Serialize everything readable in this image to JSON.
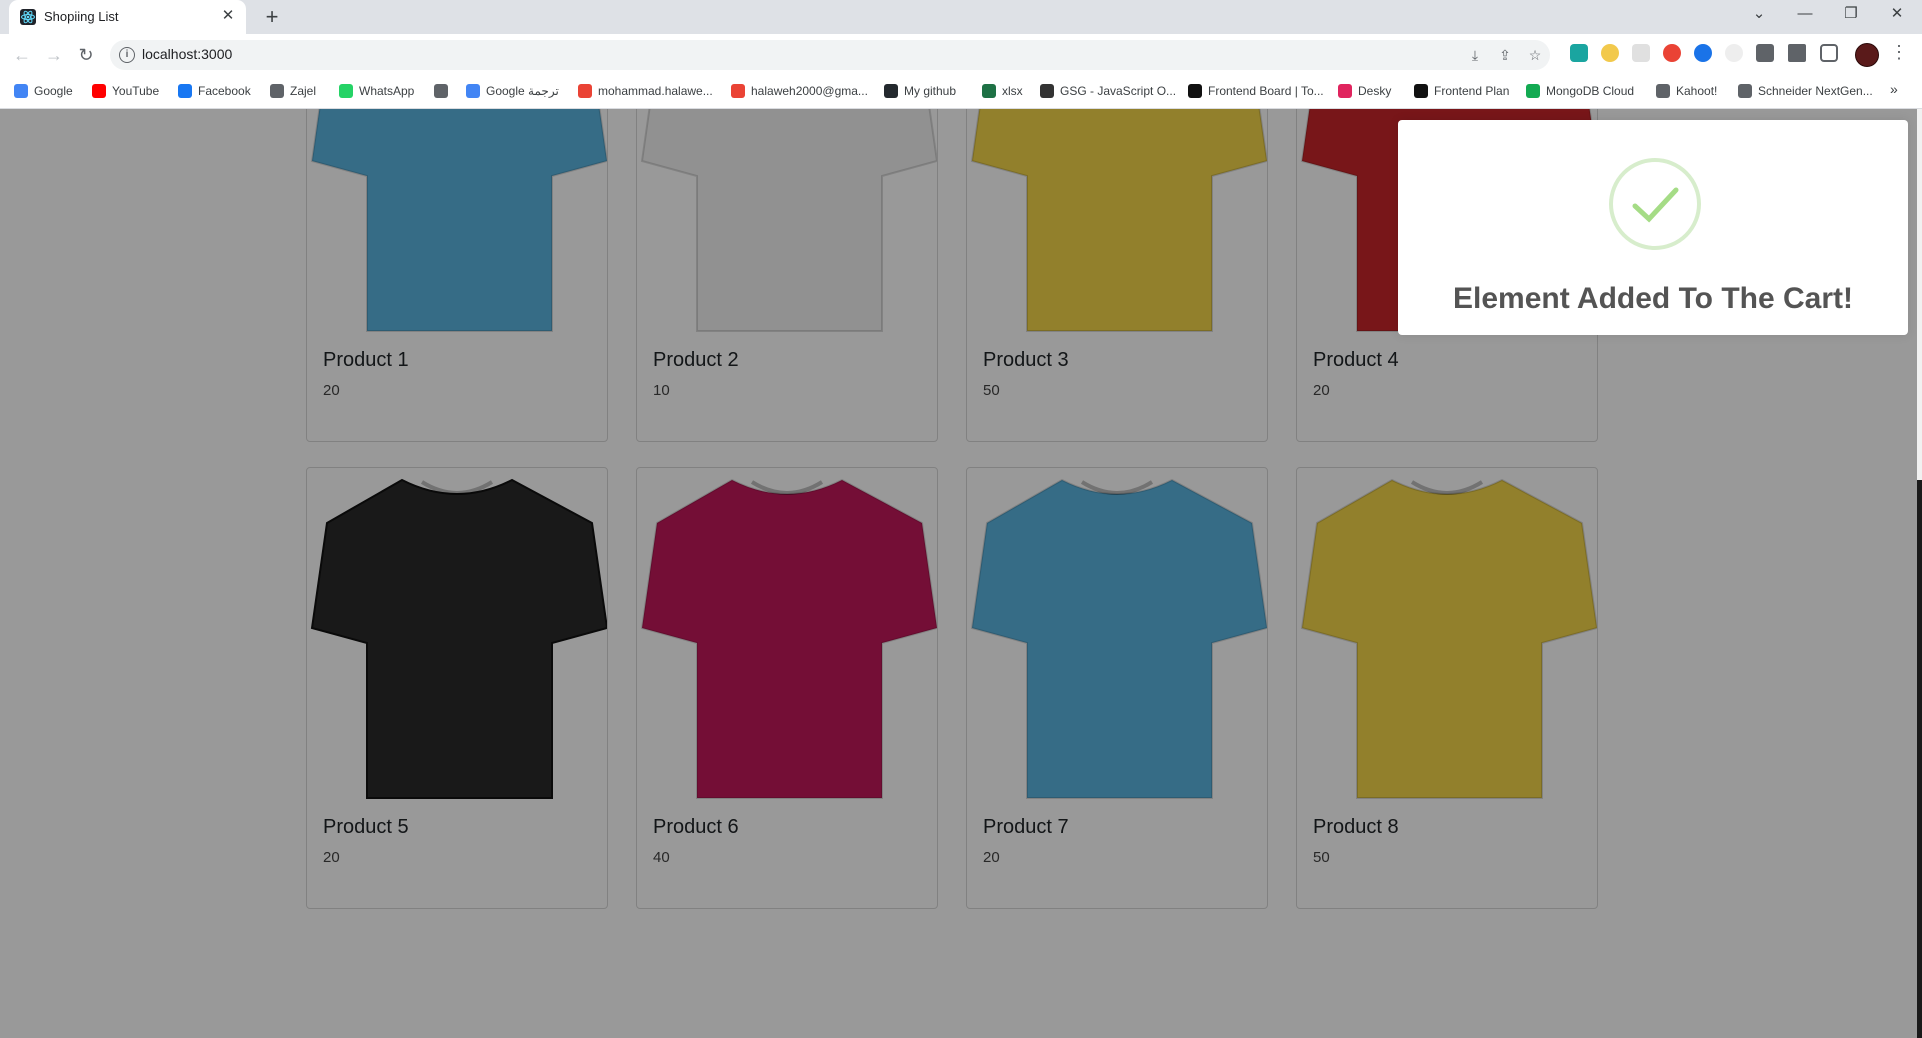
{
  "browser": {
    "tab_title": "Shopiing List",
    "tab_close": "✕",
    "new_tab": "+",
    "url": "localhost:3000",
    "window_controls": {
      "minimize": "—",
      "restore": "❐",
      "close": "✕",
      "tab_search": "⌄"
    }
  },
  "bookmarks": [
    {
      "label": "Google",
      "color": "#4285f4"
    },
    {
      "label": "YouTube",
      "color": "#ff0000"
    },
    {
      "label": "Facebook",
      "color": "#1877f2"
    },
    {
      "label": "Zajel",
      "color": "#5f6368"
    },
    {
      "label": "WhatsApp",
      "color": "#25d366"
    },
    {
      "label": "",
      "color": "#5f6368"
    },
    {
      "label": "Google ترجمة",
      "color": "#4285f4"
    },
    {
      "label": "mohammad.halawe...",
      "color": "#ea4335"
    },
    {
      "label": "halaweh2000@gma...",
      "color": "#ea4335"
    },
    {
      "label": "My github",
      "color": "#24292e"
    },
    {
      "label": "xlsx",
      "color": "#1e7145"
    },
    {
      "label": "GSG - JavaScript O...",
      "color": "#333333"
    },
    {
      "label": "Frontend Board | To...",
      "color": "#111111"
    },
    {
      "label": "Desky",
      "color": "#e0245e"
    },
    {
      "label": "Frontend Plan",
      "color": "#111111"
    },
    {
      "label": "MongoDB Cloud",
      "color": "#13aa52"
    },
    {
      "label": "Kahoot!",
      "color": "#5f6368"
    },
    {
      "label": "Schneider NextGen...",
      "color": "#5f6368"
    }
  ],
  "products": [
    {
      "name": "Product 1",
      "price": "20",
      "color": "#5bb4e0"
    },
    {
      "name": "Product 2",
      "price": "10",
      "color": "#f2f2f2"
    },
    {
      "name": "Product 3",
      "price": "50",
      "color": "#f3d54a"
    },
    {
      "name": "Product 4",
      "price": "20",
      "color": "#c9262a"
    },
    {
      "name": "Product 5",
      "price": "20",
      "color": "#2a2a2a"
    },
    {
      "name": "Product 6",
      "price": "40",
      "color": "#c2185b"
    },
    {
      "name": "Product 7",
      "price": "20",
      "color": "#5bb4e0"
    },
    {
      "name": "Product 8",
      "price": "50",
      "color": "#f3d54a"
    }
  ],
  "alert": {
    "title": "Element Added To The Cart!",
    "icon": "success-check",
    "icon_color": "#a5dc86"
  }
}
